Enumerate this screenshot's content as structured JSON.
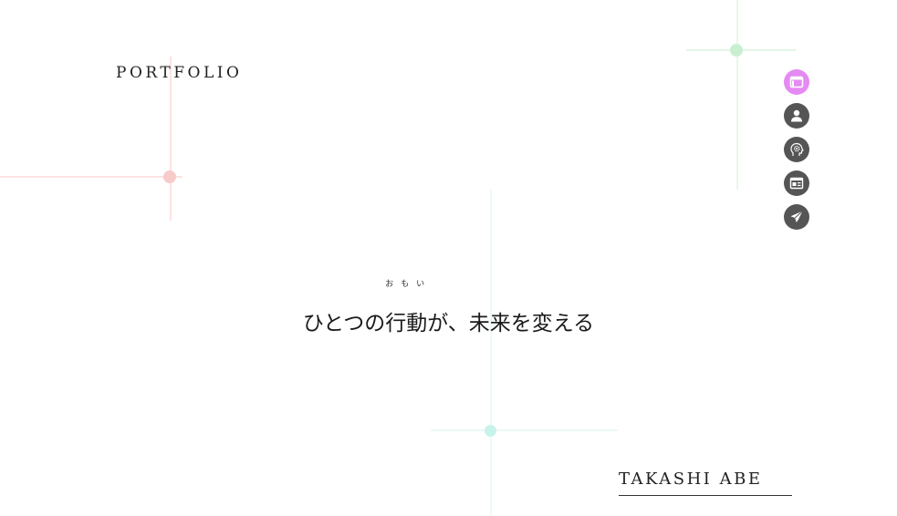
{
  "site": {
    "logo": "PORTFOLIO",
    "author": "TAKASHI ABE"
  },
  "hero": {
    "tagline_before": "ひとつの",
    "tagline_ruby_base": "行動",
    "tagline_ruby_text": "おもい",
    "tagline_after": "が、未来を変える"
  },
  "nav": {
    "items": [
      {
        "icon": "window-icon",
        "active": true
      },
      {
        "icon": "user-icon",
        "active": false
      },
      {
        "icon": "head-gear-icon",
        "active": false
      },
      {
        "icon": "newspaper-icon",
        "active": false
      },
      {
        "icon": "paper-plane-icon",
        "active": false
      }
    ]
  },
  "colors": {
    "nav_active": "#e58af2",
    "nav_default": "#555555",
    "accent_pink": "#f8caca",
    "accent_green": "#c8f0d0",
    "accent_teal": "#c8f3ea"
  }
}
